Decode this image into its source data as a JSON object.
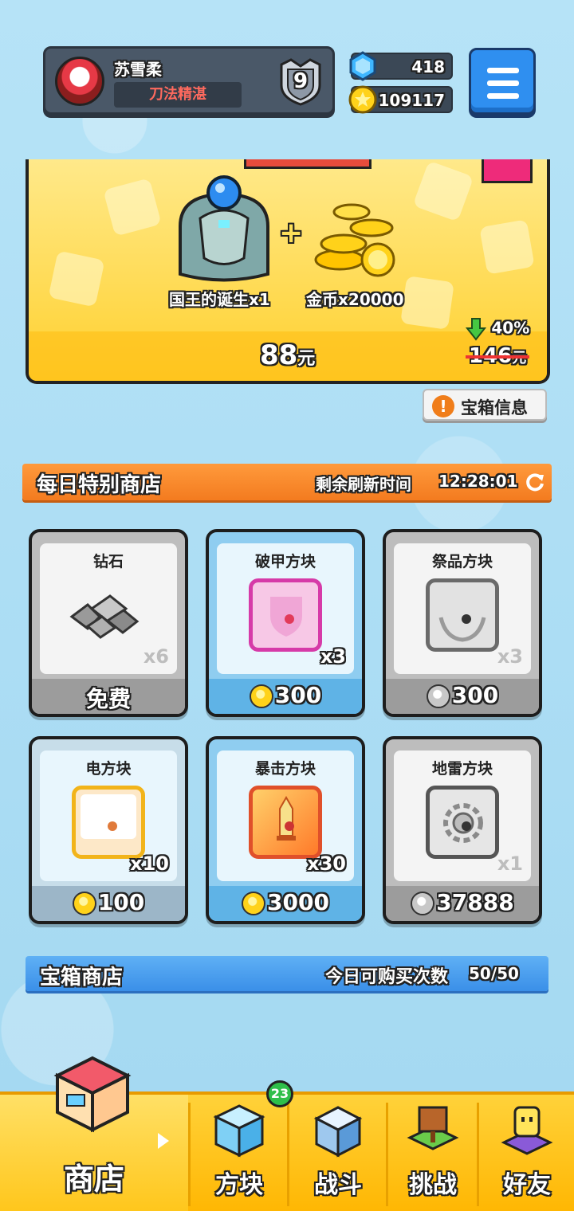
{
  "profile": {
    "name": "苏雪柔",
    "title": "刀法精湛",
    "rank": "9"
  },
  "currency": {
    "gems": "418",
    "coins": "109117"
  },
  "banner": {
    "item1_label": "国王的诞生x1",
    "item2_label": "金币x20000",
    "price": "88",
    "price_unit": "元",
    "original_price": "146",
    "original_unit": "元",
    "discount": "40%"
  },
  "chest_info_button": "宝箱信息",
  "daily_shop": {
    "title": "每日特别商店",
    "refresh_label": "剩余刷新时间",
    "refresh_time": "12:28:01",
    "items": [
      {
        "name": "钻石",
        "qty": "x6",
        "price": "免费",
        "currency": "none"
      },
      {
        "name": "破甲方块",
        "qty": "x3",
        "price": "300",
        "currency": "gold"
      },
      {
        "name": "祭品方块",
        "qty": "x3",
        "price": "300",
        "currency": "silver"
      },
      {
        "name": "电方块",
        "qty": "x10",
        "price": "100",
        "currency": "gold"
      },
      {
        "name": "暴击方块",
        "qty": "x30",
        "price": "3000",
        "currency": "gold"
      },
      {
        "name": "地雷方块",
        "qty": "x1",
        "price": "37888",
        "currency": "silver"
      }
    ]
  },
  "chest_shop": {
    "title": "宝箱商店",
    "purchase_label": "今日可购买次数",
    "purchase_count": "50/50"
  },
  "nav": {
    "shop": "商店",
    "blocks": "方块",
    "battle": "战斗",
    "challenge": "挑战",
    "friends": "好友",
    "blocks_badge": "23"
  }
}
